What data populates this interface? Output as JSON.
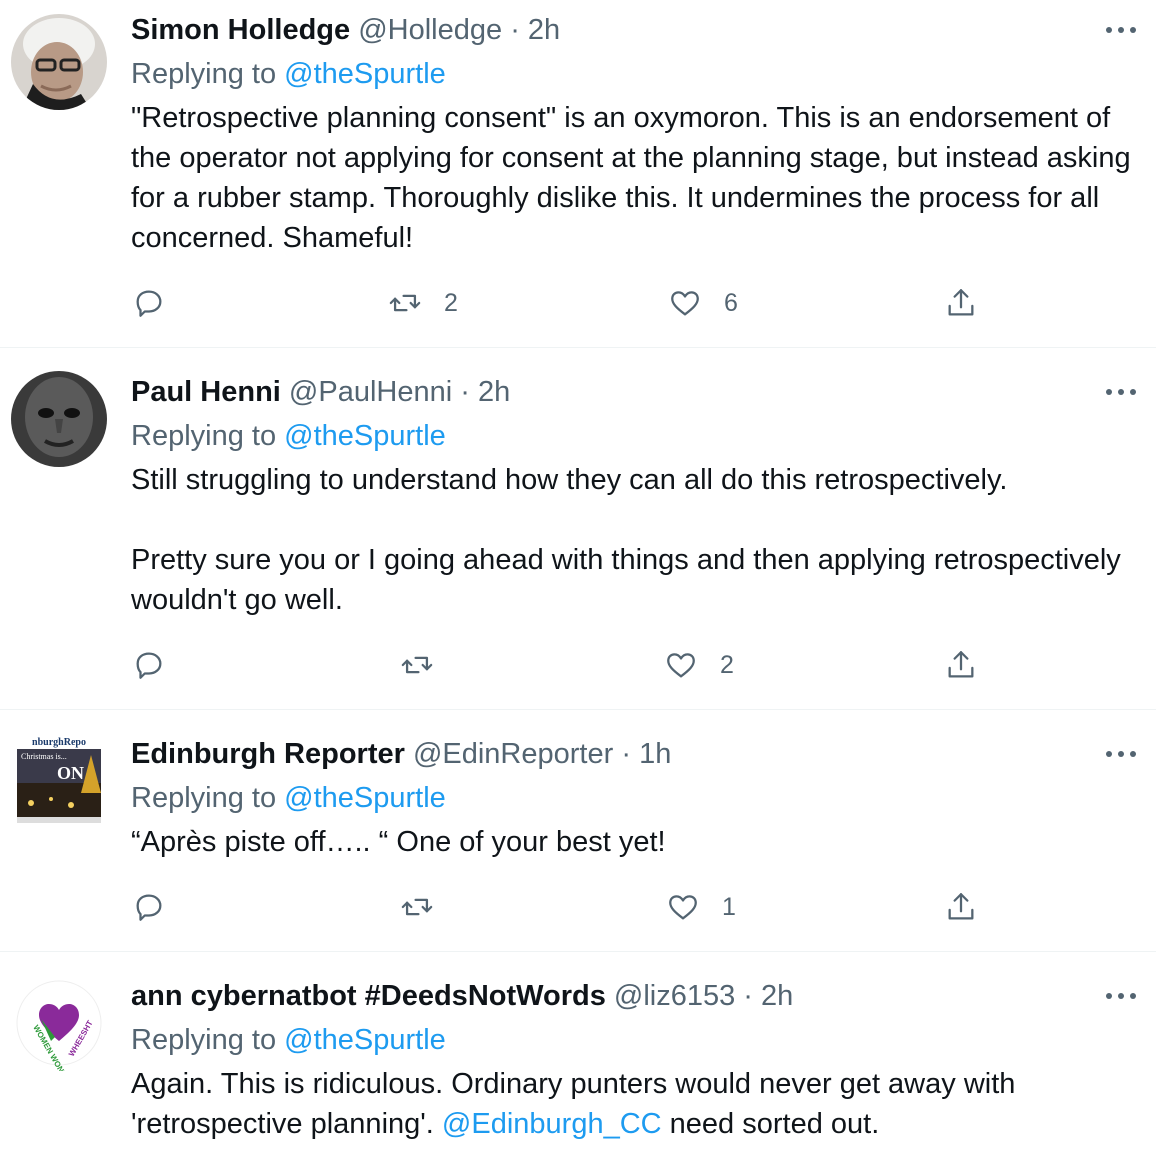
{
  "tweets": [
    {
      "name": "Simon Holledge",
      "handle": "@Holledge",
      "sep": "·",
      "time": "2h",
      "replying_prefix": "Replying to ",
      "replying_to": "@theSpurtle",
      "text": "\"Retrospective planning consent\" is an oxymoron. This is an endorsement of the operator not applying for consent at the planning stage, but instead asking for a rubber stamp. Thoroughly dislike this. It undermines the process for all concerned. Shameful!",
      "retweets": "2",
      "likes": "6"
    },
    {
      "name": "Paul Henni",
      "handle": "@PaulHenni",
      "sep": "·",
      "time": "2h",
      "replying_prefix": "Replying to ",
      "replying_to": "@theSpurtle",
      "text_p1": "Still struggling to understand how they can all do this retrospectively.",
      "text_p2": "Pretty sure you or I going ahead with things and then applying retrospectively wouldn't go well.",
      "retweets": "",
      "likes": "2"
    },
    {
      "name": "Edinburgh Reporter",
      "handle": "@EdinReporter",
      "sep": "·",
      "time": "1h",
      "replying_prefix": "Replying to ",
      "replying_to": "@theSpurtle",
      "text": "“Après piste off….. “ One of your best yet!",
      "avatar_text_top": "nburghRepo",
      "avatar_text_mid": "Christmas is...",
      "avatar_text_on": "ON",
      "retweets": "",
      "likes": "1"
    },
    {
      "name": "ann cybernatbot #DeedsNotWords",
      "handle": "@liz6153",
      "sep": "·",
      "time": "2h",
      "replying_prefix": "Replying to ",
      "replying_to": "@theSpurtle",
      "text_before": "Again. This is ridiculous. Ordinary punters would never get away with 'retrospective planning'. ",
      "text_mention": "@Edinburgh_CC",
      "text_after": " need sorted out.",
      "avatar_text_left": "WOMEN WONT",
      "avatar_text_right": "WHEESHT"
    }
  ],
  "colors": {
    "text": "#0f1419",
    "muted": "#536471",
    "link": "#1d9bf0",
    "divider": "#eff3f4"
  }
}
